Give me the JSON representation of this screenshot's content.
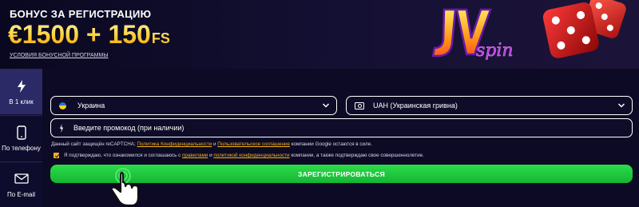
{
  "banner": {
    "caption": "БОНУС ЗА РЕГИСТРАЦИЮ",
    "amount": "€1500 + 150",
    "amount_suffix": "FS",
    "terms_link": "УСЛОВИЯ БОНУСНОЙ ПРОГРАММЫ"
  },
  "logo": {
    "brand_letters": "JV",
    "brand_word": "spin"
  },
  "sidebar": {
    "items": [
      {
        "label": "В 1 клик",
        "icon": "lightning-icon",
        "active": true
      },
      {
        "label": "По телефону",
        "icon": "phone-icon",
        "active": false
      },
      {
        "label": "По E-mail",
        "icon": "envelope-icon",
        "active": false
      }
    ]
  },
  "form": {
    "country": {
      "value": "Украина",
      "icon": "ukraine-flag-icon"
    },
    "currency": {
      "value": "UAH (Украинская гривна)",
      "icon": "banknote-icon"
    },
    "promo": {
      "placeholder": "Введите промокод (при наличии)",
      "icon": "promo-icon"
    },
    "recaptcha": {
      "prefix": "Данный сайт защищён reCAPTCHA;",
      "privacy_link": "Политика Конфиденциальности",
      "and": "и",
      "terms_link": "Пользовательское соглашение",
      "suffix": "компании Google остаются в силе."
    },
    "consent": {
      "prefix": "Я подтверждаю, что ознакомился и соглашаюсь с",
      "rules_link": "правилами",
      "and": "и",
      "privacy_link": "политикой конфиденциальности",
      "suffix": "компании, а также подтверждаю свое совершеннолетие.",
      "checked": true
    },
    "register_label": "ЗАРЕГИСТРИРОВАТЬСЯ"
  },
  "colors": {
    "accent": "#f6b21a",
    "button": "#1fc93e",
    "background": "#0c0a24",
    "active_tab": "#2c2a66"
  }
}
